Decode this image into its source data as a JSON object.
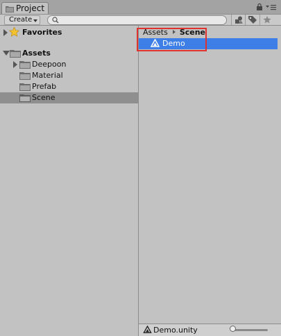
{
  "window": {
    "tab_label": "Project",
    "icons": [
      "folder-icon",
      "lock-icon",
      "menu-icon"
    ]
  },
  "toolbar": {
    "create_label": "Create",
    "search_placeholder": "",
    "icons": [
      "search-icon",
      "filter-by-type-icon",
      "filter-by-label-icon",
      "favorite-star-icon"
    ]
  },
  "tree": {
    "favorites": "Favorites",
    "assets": "Assets",
    "children": [
      "Deepoon",
      "Material",
      "Prefab",
      "Scene"
    ],
    "selected": "Scene"
  },
  "breadcrumb": {
    "root": "Assets",
    "current": "Scene"
  },
  "assets_list": [
    {
      "name": "Demo",
      "icon": "unity-scene-icon",
      "selected": true
    }
  ],
  "status": {
    "selected_file": "Demo.unity",
    "zoom_slider_value": 0
  },
  "colors": {
    "selection_blue": "#3d7fe6",
    "highlight_red": "#e0322f",
    "panel_gray": "#c2c2c2"
  }
}
